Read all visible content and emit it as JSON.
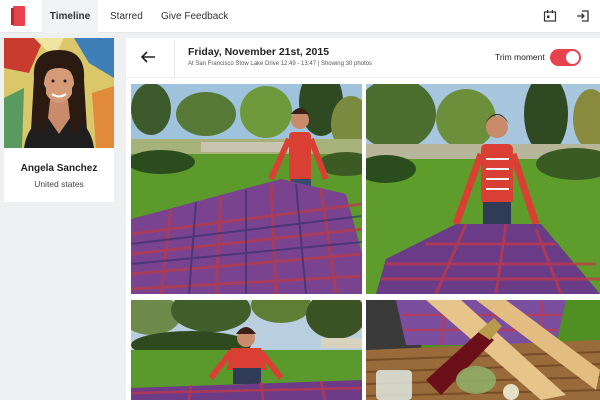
{
  "nav": {
    "logo_icon": "book-icon",
    "tabs": [
      {
        "label": "Timeline",
        "active": true
      },
      {
        "label": "Starred",
        "active": false
      },
      {
        "label": "Give Feedback",
        "active": false
      }
    ],
    "icons": [
      "calendar-icon",
      "sign-out-icon"
    ]
  },
  "profile": {
    "name": "Angela Sanchez",
    "location": "United states"
  },
  "moment": {
    "date": "Friday, November 21st, 2015",
    "subtitle": "At San Francisco Stow Lake Drive 12:49 - 13:47 | Showing 30 photos",
    "trim_label": "Trim moment",
    "trim_enabled": true
  },
  "colors": {
    "accent": "#e8434c",
    "background": "#eef0f2",
    "card": "#ffffff"
  }
}
